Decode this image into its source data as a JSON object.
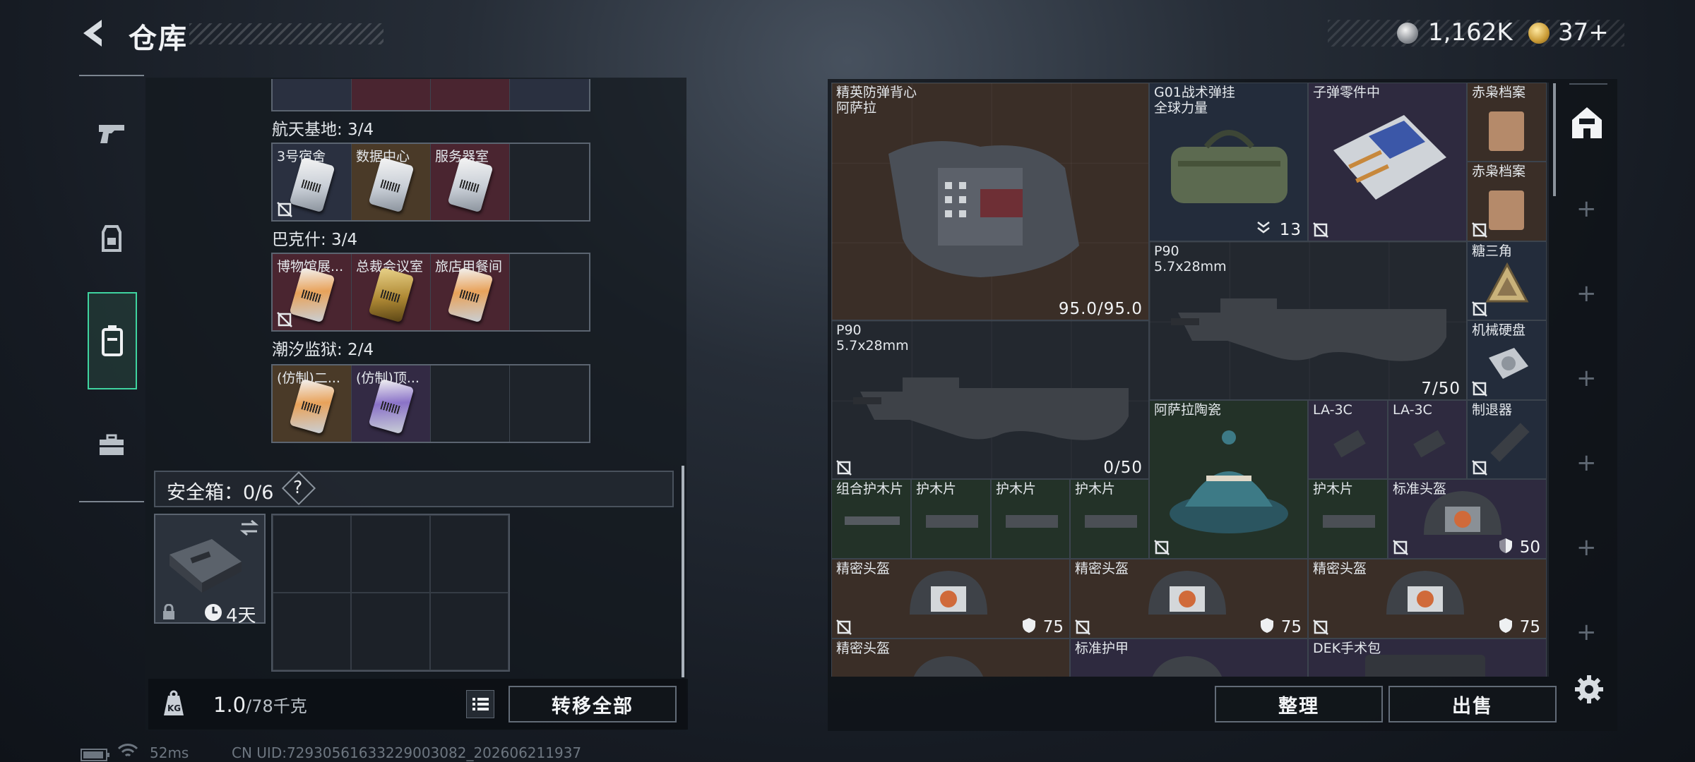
{
  "header": {
    "title": "仓库",
    "currency": [
      {
        "name": "silver-coin",
        "value": "1,162K"
      },
      {
        "name": "gold-coin",
        "value": "37+"
      }
    ]
  },
  "left_tabs": [
    {
      "icon": "pistol-icon"
    },
    {
      "icon": "backpack-icon"
    },
    {
      "icon": "keycard-case-icon",
      "active": true
    },
    {
      "icon": "toolbox-icon"
    }
  ],
  "regions": [
    {
      "title": "航天基地: 3/4",
      "cards": [
        {
          "label": "3号宿舍",
          "color": "blue"
        },
        {
          "label": "数据中心",
          "color": "gold"
        },
        {
          "label": "服务器室",
          "color": "red"
        },
        {
          "label": "",
          "color": "empty"
        }
      ]
    },
    {
      "title": "巴克什: 3/4",
      "cards": [
        {
          "label": "博物馆展...",
          "color": "red"
        },
        {
          "label": "总裁会议室",
          "color": "red"
        },
        {
          "label": "旅店用餐间",
          "color": "red"
        },
        {
          "label": "",
          "color": "empty"
        }
      ]
    },
    {
      "title": "潮汐监狱: 2/4",
      "cards": [
        {
          "label": "(仿制)二...",
          "color": "gold"
        },
        {
          "label": "(仿制)顶...",
          "color": "purple"
        },
        {
          "label": "",
          "color": "empty"
        },
        {
          "label": "",
          "color": "empty"
        }
      ]
    }
  ],
  "safe_box": {
    "label": "安全箱：0/6",
    "help": "?",
    "duration": "4天"
  },
  "footer": {
    "weight": "1.0",
    "weight_max": "/78千克",
    "transfer_all": "转移全部"
  },
  "status": {
    "ping": "52ms",
    "uid": "CN UID:7293056163322900308​2_202606211937"
  },
  "items": [
    {
      "id": "vest",
      "name": "精英防弹背心\n阿萨拉",
      "value": "95.0/95.0",
      "color": "brown"
    },
    {
      "id": "chest-rig",
      "name": "G01战术弹挂\n全球力量",
      "value": "13",
      "color": "navy"
    },
    {
      "id": "ammo-parts",
      "name": "子弹零件中",
      "value": "",
      "color": "purple"
    },
    {
      "id": "owl-file-1",
      "name": "赤枭档案",
      "value": "",
      "color": "brown"
    },
    {
      "id": "owl-file-2",
      "name": "赤枭档案",
      "value": "",
      "color": "brown"
    },
    {
      "id": "p90-a",
      "name": "P90\n5.7x28mm",
      "value": "7/50",
      "color": "dark"
    },
    {
      "id": "candy-triangle",
      "name": "糖三角",
      "value": "",
      "color": "navy"
    },
    {
      "id": "hard-disk",
      "name": "机械硬盘",
      "value": "",
      "color": "navy"
    },
    {
      "id": "p90-b",
      "name": "P90\n5.7x28mm",
      "value": "0/50",
      "color": "dark"
    },
    {
      "id": "ceramic",
      "name": "阿萨拉陶瓷",
      "value": "",
      "color": "green"
    },
    {
      "id": "la3c-1",
      "name": "LA-3C",
      "value": "",
      "color": "purple"
    },
    {
      "id": "la3c-2",
      "name": "LA-3C",
      "value": "",
      "color": "purple"
    },
    {
      "id": "muzzle",
      "name": "制退器",
      "value": "",
      "color": "navy"
    },
    {
      "id": "handguard-combo",
      "name": "组合护木片",
      "value": "",
      "color": "green"
    },
    {
      "id": "handguard-1",
      "name": "护木片",
      "value": "",
      "color": "green"
    },
    {
      "id": "handguard-2",
      "name": "护木片",
      "value": "",
      "color": "green"
    },
    {
      "id": "handguard-3",
      "name": "护木片",
      "value": "",
      "color": "green"
    },
    {
      "id": "handguard-4",
      "name": "护木片",
      "value": "",
      "color": "green"
    },
    {
      "id": "std-helmet",
      "name": "标准头盔",
      "value": "50",
      "color": "purple"
    },
    {
      "id": "helmet-1",
      "name": "精密头盔",
      "value": "75",
      "color": "brown"
    },
    {
      "id": "helmet-2",
      "name": "精密头盔",
      "value": "75",
      "color": "brown"
    },
    {
      "id": "helmet-3",
      "name": "精密头盔",
      "value": "75",
      "color": "brown"
    },
    {
      "id": "helmet-4",
      "name": "精密头盔",
      "value": "",
      "color": "brown"
    },
    {
      "id": "std-armor",
      "name": "标准护甲",
      "value": "",
      "color": "purple"
    },
    {
      "id": "dek-kit",
      "name": "DEK手术包",
      "value": "",
      "color": "purple"
    }
  ],
  "right_buttons": {
    "organize": "整理",
    "sell": "出售"
  }
}
